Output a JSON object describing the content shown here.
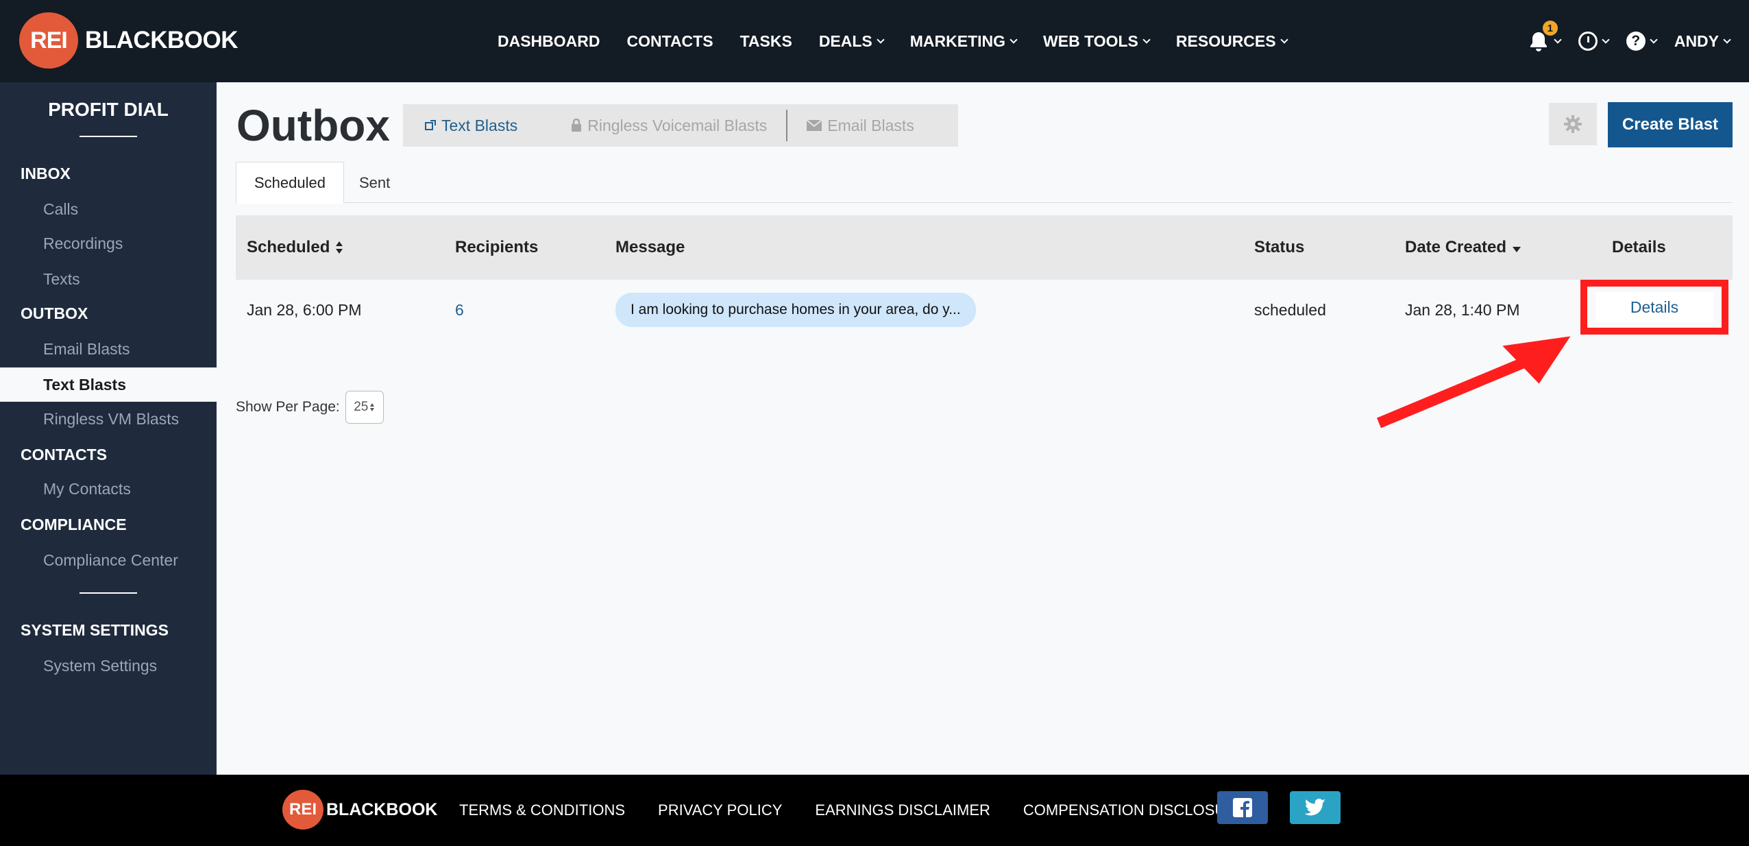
{
  "brand": {
    "logo_mark": "REI",
    "logo_text": "BLACKBOOK"
  },
  "topnav": {
    "items": [
      {
        "label": "DASHBOARD",
        "dropdown": false
      },
      {
        "label": "CONTACTS",
        "dropdown": false
      },
      {
        "label": "TASKS",
        "dropdown": false
      },
      {
        "label": "DEALS",
        "dropdown": true
      },
      {
        "label": "MARKETING",
        "dropdown": true
      },
      {
        "label": "WEB TOOLS",
        "dropdown": true
      },
      {
        "label": "RESOURCES",
        "dropdown": true
      }
    ],
    "notifications_count": "1",
    "user_name": "ANDY",
    "icons": [
      "bell-icon",
      "clock-icon",
      "help-icon"
    ]
  },
  "sidebar": {
    "title": "PROFIT DIAL",
    "sections": [
      {
        "label": "INBOX",
        "items": [
          "Calls",
          "Recordings",
          "Texts"
        ]
      },
      {
        "label": "OUTBOX",
        "items": [
          "Email Blasts",
          "Text Blasts",
          "Ringless VM Blasts"
        ],
        "active": "Text Blasts"
      },
      {
        "label": "CONTACTS",
        "items": [
          "My Contacts"
        ]
      },
      {
        "label": "COMPLIANCE",
        "items": [
          "Compliance Center"
        ]
      },
      {
        "label": "SYSTEM SETTINGS",
        "items": [
          "System Settings"
        ]
      }
    ]
  },
  "main": {
    "title": "Outbox",
    "channel_tabs": [
      {
        "label": "Text Blasts",
        "icon": "external-link-icon",
        "active": true
      },
      {
        "label": "Ringless Voicemail Blasts",
        "icon": "lock-icon",
        "active": false
      },
      {
        "label": "Email Blasts",
        "icon": "envelope-icon",
        "active": false
      }
    ],
    "settings_icon": "gear-icon",
    "create_button": "Create Blast",
    "subtabs": [
      {
        "label": "Scheduled",
        "active": true
      },
      {
        "label": "Sent",
        "active": false
      }
    ],
    "table": {
      "columns": [
        "Scheduled",
        "Recipients",
        "Message",
        "Status",
        "Date Created",
        "Details"
      ],
      "rows": [
        {
          "scheduled": "Jan 28, 6:00 PM",
          "recipients": "6",
          "message": "I am looking to purchase homes in your area, do y...",
          "status": "scheduled",
          "date_created": "Jan 28, 1:40 PM",
          "details": "Details"
        }
      ]
    },
    "per_page_label": "Show Per Page:",
    "per_page_value": "25"
  },
  "footer": {
    "logo_mark": "REI",
    "logo_text": "BLACKBOOK",
    "links": [
      "TERMS & CONDITIONS",
      "PRIVACY POLICY",
      "EARNINGS DISCLAIMER",
      "COMPENSATION DISCLOSURE"
    ],
    "social": [
      "facebook-icon",
      "twitter-icon"
    ]
  },
  "colors": {
    "nav_bg": "#131b24",
    "sidebar_bg": "#1f2b3d",
    "accent": "#14578f",
    "logo": "#e35a3a",
    "highlight": "#ff1e1e"
  }
}
